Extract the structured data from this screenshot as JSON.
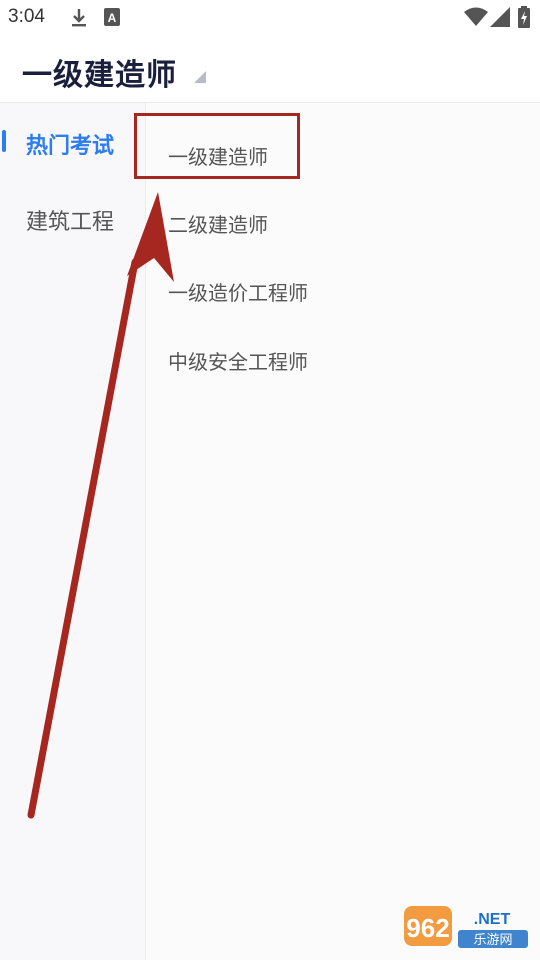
{
  "status_bar": {
    "time": "3:04",
    "icons": [
      "download-icon",
      "a-notification-icon",
      "wifi-icon",
      "signal-icon",
      "battery-charging-icon"
    ]
  },
  "header": {
    "title": "一级建造师",
    "caret_icon": "dropdown-triangle-icon"
  },
  "sidebar": {
    "items": [
      {
        "label": "热门考试",
        "active": true
      },
      {
        "label": "建筑工程",
        "active": false
      }
    ]
  },
  "exams": {
    "items": [
      {
        "label": "一级建造师"
      },
      {
        "label": "二级建造师"
      },
      {
        "label": "一级造价工程师"
      },
      {
        "label": "中级安全工程师"
      }
    ]
  },
  "annotation": {
    "color": "#a6271f",
    "highlight": "red-box-around-first-exam",
    "arrow": "red-arrow-pointing-up"
  },
  "watermark": {
    "text": "962.NET",
    "subtext": "乐游网"
  },
  "colors": {
    "accent": "#2d7cf0",
    "title": "#1b1f3d",
    "annotation_red": "#a6271f"
  }
}
